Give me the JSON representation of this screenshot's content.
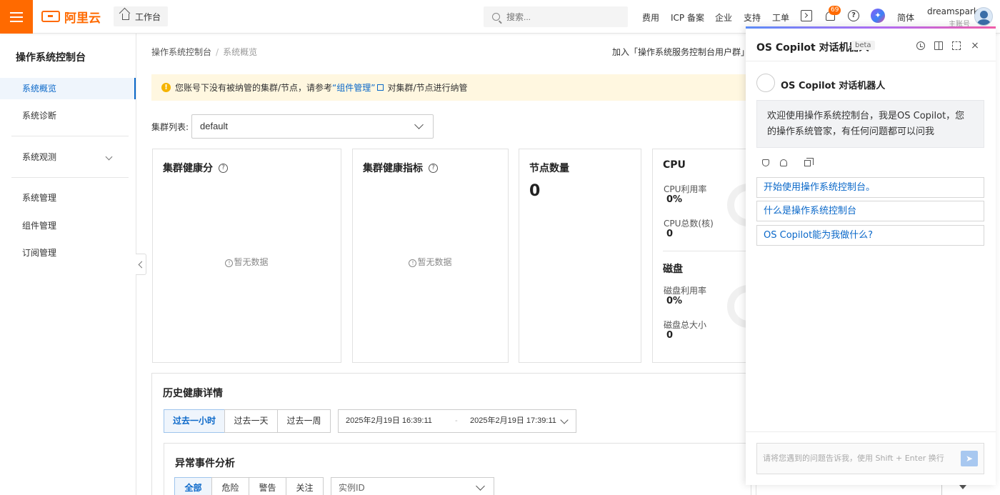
{
  "topbar": {
    "brand": "阿里云",
    "workbench": "工作台",
    "search_placeholder": "搜索...",
    "links": [
      "费用",
      "ICP 备案",
      "企业",
      "支持",
      "工单"
    ],
    "notification_count": "69",
    "language": "简体",
    "user_name": "dreamspark",
    "user_role": "主账号",
    "accent_color": "#ff6a00"
  },
  "sidebar": {
    "title": "操作系统控制台",
    "items": [
      "系统概览",
      "系统诊断",
      "系统观测",
      "系统管理",
      "组件管理",
      "订阅管理"
    ],
    "active_color": "#0a68c9"
  },
  "main": {
    "breadcrumb": [
      "操作系统控制台",
      "系统概览"
    ],
    "join_text": "加入「操作系统服务控制台用户群」获",
    "notice": {
      "prefix": "您账号下没有被纳管的集群/节点，请参考",
      "link": "“组件管理”",
      "suffix": "对集群/节点进行纳管"
    },
    "cluster_label": "集群列表:",
    "cluster_value": "default",
    "cards": {
      "health_score": "集群健康分",
      "health_metrics": "集群健康指标",
      "no_data": "暂无数据",
      "node_count_title": "节点数量",
      "node_count": "0",
      "cpu_title": "CPU",
      "cpu_usage_label": "CPU利用率",
      "cpu_usage": "0%",
      "cpu_total_label": "CPU总数(核)",
      "cpu_total": "0",
      "disk_title": "磁盘",
      "disk_usage_label": "磁盘利用率",
      "disk_usage": "0%",
      "disk_total_label": "磁盘总大小",
      "disk_total": "0"
    },
    "history": {
      "title": "历史健康详情",
      "ranges": [
        "过去一小时",
        "过去一天",
        "过去一周"
      ],
      "start": "2025年2月19日 16:39:11",
      "sep": "-",
      "end": "2025年2月19日 17:39:11",
      "anomaly_title": "异常事件分析",
      "filters": [
        "全部",
        "危险",
        "警告",
        "关注"
      ],
      "instance_placeholder": "实例ID"
    }
  },
  "copilot": {
    "title": "OS Copilot 对话机器人",
    "beta": "beta",
    "bot_name": "OS Copilot 对话机器人",
    "welcome": "欢迎使用操作系统控制台，我是OS Copilot，您的操作系统管家，有任何问题都可以问我",
    "suggestions": [
      "开始使用操作系统控制台。",
      "什么是操作系统控制台",
      "OS Copilot能为我做什么?"
    ],
    "input_placeholder": "请将您遇到的问题告诉我，使用 Shift + Enter 换行"
  }
}
